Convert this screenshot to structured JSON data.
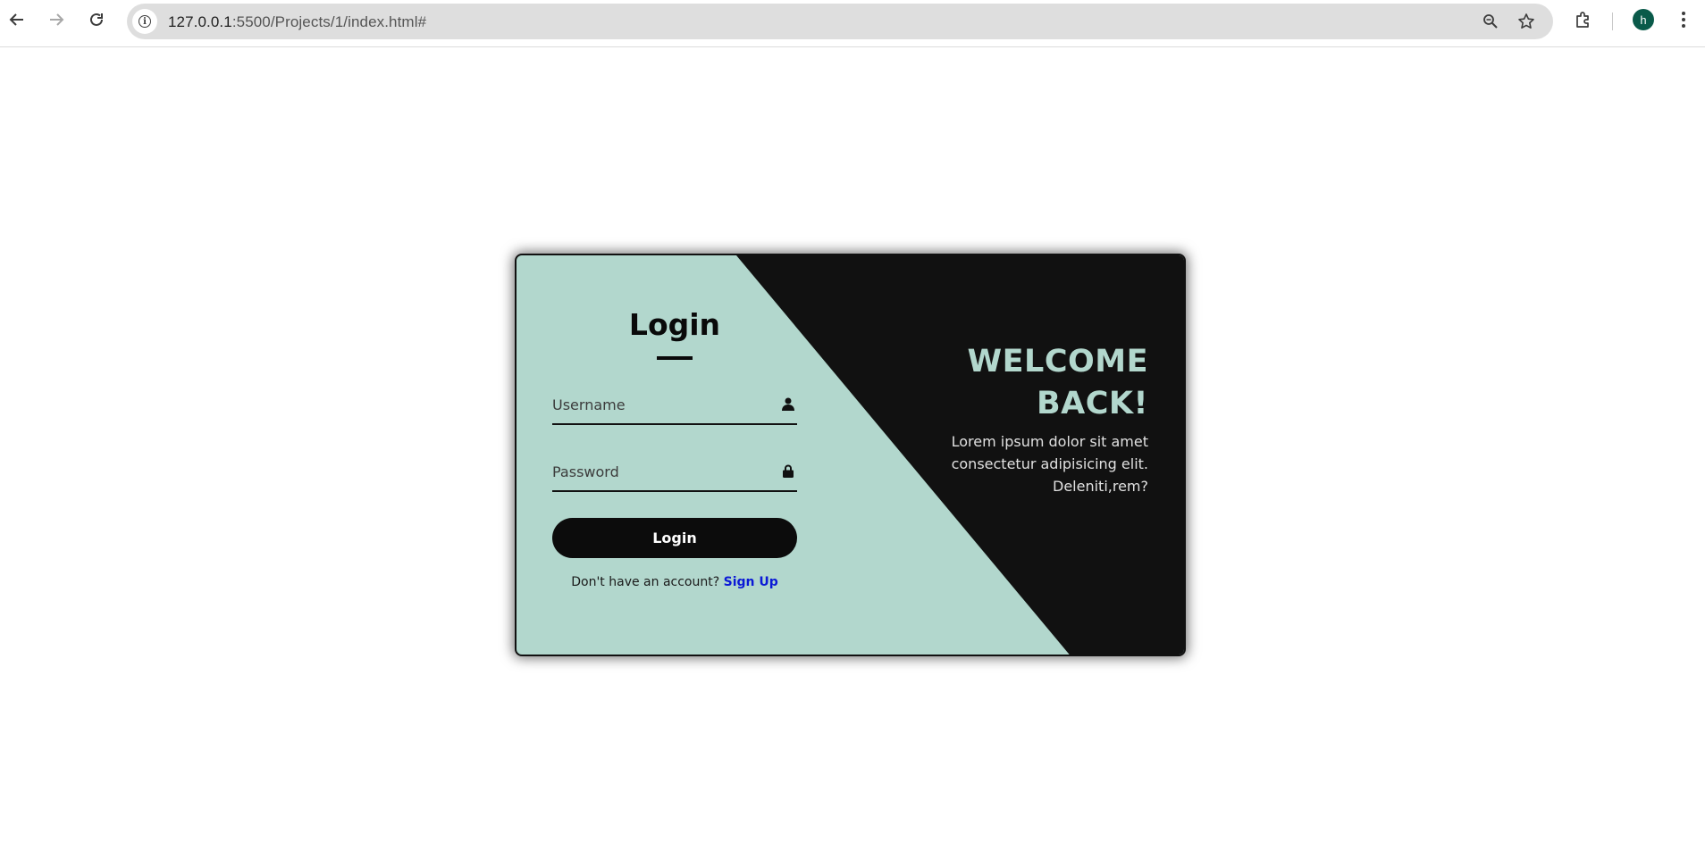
{
  "browser": {
    "url_host": "127.0.0.1",
    "url_rest": ":5500/Projects/1/index.html#",
    "profile_initial": "h",
    "profile_color": "#0a5a4a",
    "icons": [
      "back-icon",
      "forward-icon",
      "reload-icon",
      "site-info-icon",
      "zoom-icon",
      "bookmark-star-icon",
      "extensions-icon",
      "menu-icon"
    ]
  },
  "login": {
    "title": "Login",
    "username_placeholder": "Username",
    "password_placeholder": "Password",
    "username_value": "",
    "password_value": "",
    "button_label": "Login",
    "signup_prompt": "Don't have an account?",
    "signup_link": "Sign Up"
  },
  "welcome": {
    "title": "WELCOME BACK!",
    "text": "Lorem ipsum dolor sit amet consectetur adipisicing elit. Deleniti,rem?"
  },
  "colors": {
    "accent": "#b2d7cd",
    "dark": "#111111",
    "link": "#0b19d6"
  }
}
